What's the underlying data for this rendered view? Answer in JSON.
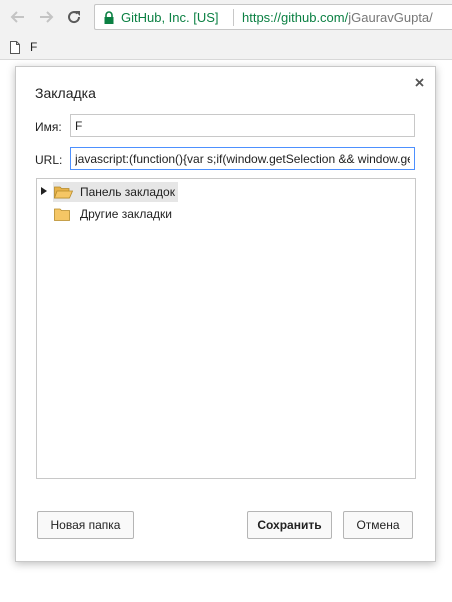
{
  "browser": {
    "security_label": "GitHub, Inc. [US]",
    "url_scheme_host": "https://github.com/",
    "url_path": "jGauravGupta/",
    "bookmark_item": "F"
  },
  "dialog": {
    "title": "Закладка",
    "name_label": "Имя:",
    "name_value": "F",
    "url_label": "URL:",
    "url_value": "javascript:(function(){var s;if(window.getSelection && window.getSelection",
    "folders": [
      {
        "label": "Панель закладок",
        "selected": true,
        "expandable": true
      },
      {
        "label": "Другие закладки",
        "selected": false,
        "expandable": false
      }
    ],
    "new_folder_button": "Новая папка",
    "save_button": "Сохранить",
    "cancel_button": "Отмена"
  },
  "colors": {
    "secure_green": "#0b8043",
    "folder_yellow": "#f5c665",
    "focus_blue": "#4d90fe"
  }
}
